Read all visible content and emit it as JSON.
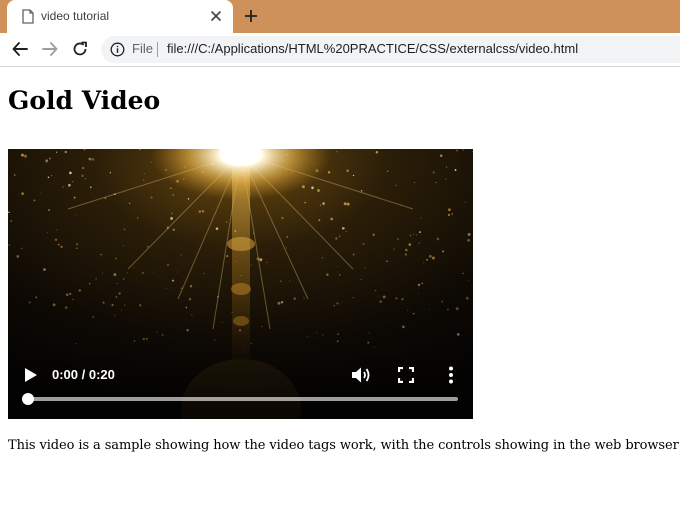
{
  "browser": {
    "tab": {
      "title": "video tutorial",
      "icon": "page-icon"
    },
    "new_tab_icon": "plus-icon",
    "address_bar": {
      "scheme_label": "File",
      "url": "file:///C:/Applications/HTML%20PRACTICE/CSS/externalcss/video.html",
      "icon": "info-icon"
    },
    "colors": {
      "tabstrip": "#cf915a",
      "omnibox": "#f1f3f4"
    }
  },
  "page": {
    "heading": "Gold Video",
    "video": {
      "time": "0:00 / 0:20",
      "progress": 0,
      "controls": [
        "play-icon",
        "volume-icon",
        "fullscreen-icon",
        "more-vert-icon"
      ]
    },
    "caption": "This video is a sample showing how the video tags work, with the controls showing in the web browser"
  }
}
